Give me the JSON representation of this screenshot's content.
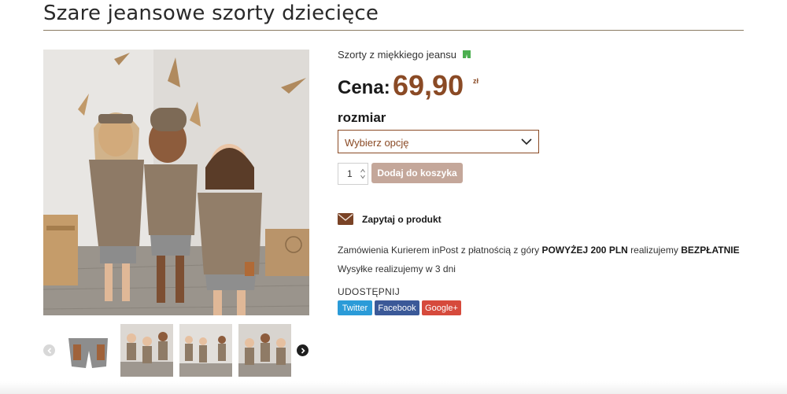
{
  "product": {
    "title": "Szare jeansowe szorty dziecięce",
    "subtitle": "Szorty z miękkiego jeansu",
    "subtitle_icon": "green-shorts-emoji",
    "price_label": "Cena:",
    "price_value": "69,90",
    "currency": "zł",
    "size_label": "rozmiar",
    "size_select": {
      "placeholder": "Wybierz opcję"
    },
    "quantity": "1",
    "add_to_cart_label": "Dodaj do koszyka",
    "ask_label": "Zapytaj o produkt",
    "shipping_line_1_a": "Zamówienia Kurierem inPost z płatnością z góry ",
    "shipping_line_1_b": "POWYŻEJ 200 PLN",
    "shipping_line_1_c": " realizujemy ",
    "shipping_line_1_d": "BEZPŁATNIE",
    "shipping_line_2": "Wysyłke realizujemy w 3 dni",
    "share_label": "UDOSTĘPNIJ",
    "share_buttons": [
      "Twitter",
      "Facebook",
      "Google+"
    ]
  },
  "colors": {
    "accent": "#8a4a25",
    "button": "#c4a79a",
    "twitter": "#2b9bd8",
    "facebook": "#3b5998",
    "google": "#d64a3c"
  }
}
